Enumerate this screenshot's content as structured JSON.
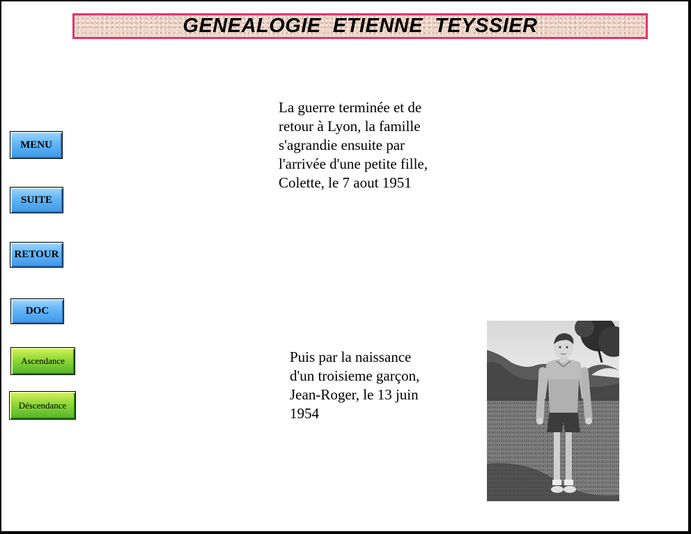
{
  "header": {
    "title": "GENEALOGIE  ETIENNE  TEYSSIER"
  },
  "nav": {
    "menu_label": "MENU",
    "suite_label": "SUITE",
    "retour_label": "RETOUR",
    "doc_label": "DOC",
    "ascendance_label": "Ascendance",
    "descendance_label": "Déscendance"
  },
  "content": {
    "paragraph_1": "La guerre terminée et de\nretour à Lyon, la famille\ns'agrandie ensuite par\nl'arrivée d'une petite fille,\nColette, le 7 aout 1951",
    "paragraph_2": "Puis par la naissance\nd'un troisieme garçon,\nJean-Roger, le 13 juin\n1954"
  },
  "colors": {
    "title_border": "#e8336e",
    "blue_button": "#62b6f6",
    "green_button": "#90d838"
  },
  "icons": {
    "photo": "boy-standing-photo"
  }
}
